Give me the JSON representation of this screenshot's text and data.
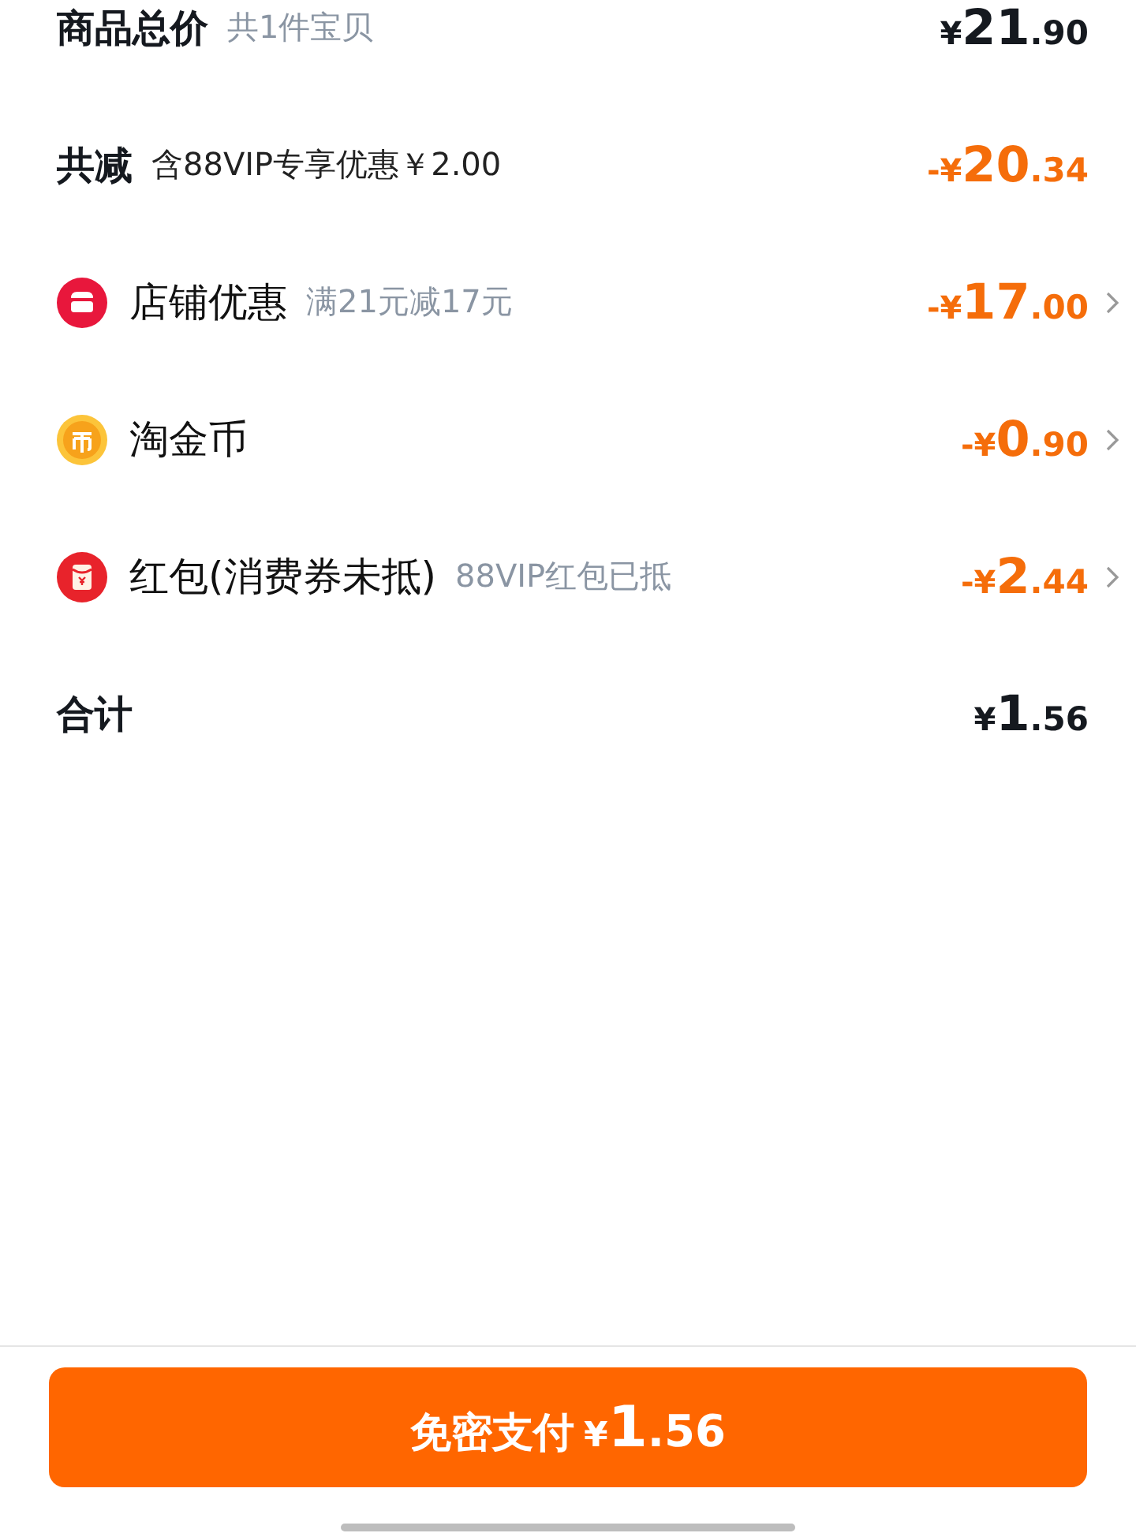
{
  "rows": [
    {
      "kind": "subtotal",
      "title": "商品总价",
      "note": "共1件宝贝",
      "amount": {
        "prefix": "¥",
        "integer": "21",
        "decimal": ".90"
      },
      "deduction": false
    },
    {
      "kind": "discount_total",
      "title": "共减",
      "note": "含88VIP专享优惠￥2.00",
      "amount": {
        "prefix": "-¥",
        "integer": "20",
        "decimal": ".34"
      },
      "deduction": true
    },
    {
      "kind": "shop",
      "title": "店铺优惠",
      "note": "满21元减17元",
      "amount": {
        "prefix": "-¥",
        "integer": "17",
        "decimal": ".00"
      },
      "deduction": true
    },
    {
      "kind": "coin",
      "title": "淘金币",
      "amount": {
        "prefix": "-¥",
        "integer": "0",
        "decimal": ".90"
      },
      "deduction": true
    },
    {
      "kind": "envelope",
      "title": "红包(消费券未抵)",
      "note": "88VIP红包已抵",
      "amount": {
        "prefix": "-¥",
        "integer": "2",
        "decimal": ".44"
      },
      "deduction": true
    },
    {
      "kind": "total",
      "title": "合计",
      "amount": {
        "prefix": "¥",
        "integer": "1",
        "decimal": ".56"
      },
      "deduction": false
    }
  ],
  "pay_button": {
    "label": "免密支付",
    "prefix": "¥",
    "integer": "1",
    "decimal": ".56"
  }
}
